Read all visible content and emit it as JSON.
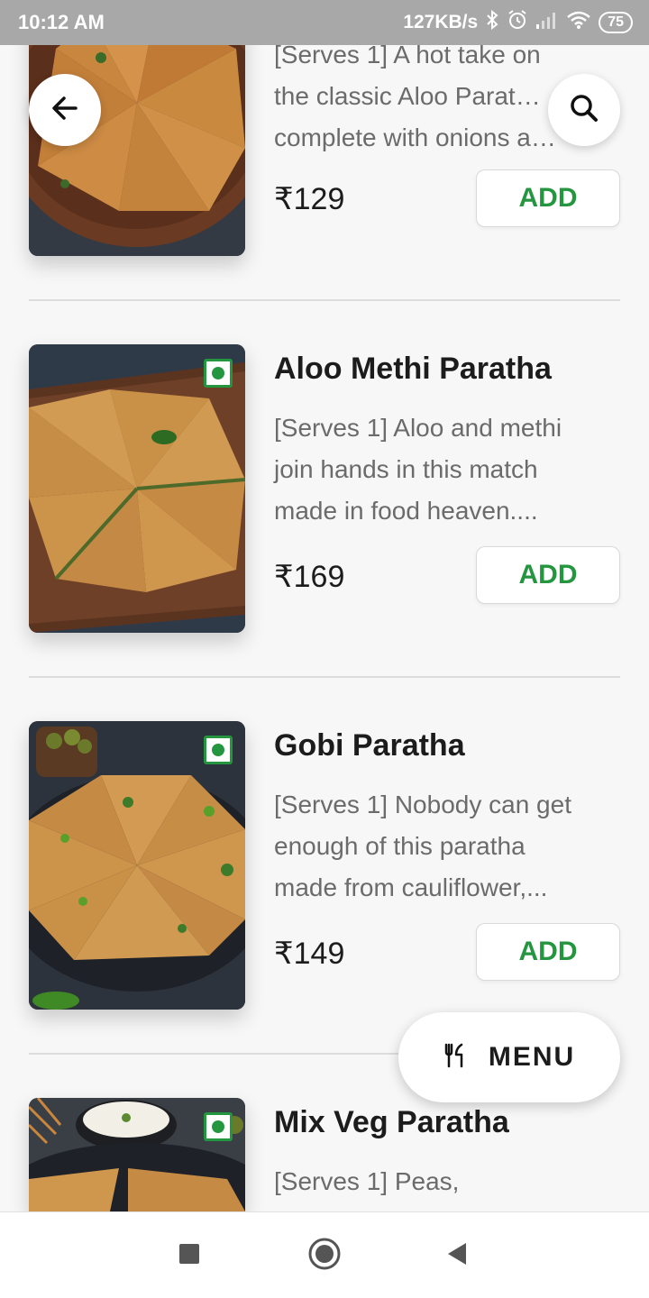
{
  "status_bar": {
    "time": "10:12 AM",
    "speed": "127KB/s",
    "battery": "75"
  },
  "header": {
    "back_icon": "arrow-left-icon",
    "search_icon": "search-icon"
  },
  "items": [
    {
      "title": "",
      "description_lines": [
        "[Serves 1] A hot take on",
        "the classic Aloo Parat…",
        "complete with onions a…"
      ],
      "price": "₹129",
      "add_label": "ADD"
    },
    {
      "title": "Aloo Methi Paratha",
      "description_lines": [
        "[Serves 1] Aloo and methi",
        "join hands in this match",
        "made in food heaven...."
      ],
      "price": "₹169",
      "add_label": "ADD"
    },
    {
      "title": "Gobi Paratha",
      "description_lines": [
        "[Serves 1] Nobody can get",
        "enough of this paratha",
        "made from cauliflower,..."
      ],
      "price": "₹149",
      "add_label": "ADD"
    },
    {
      "title": "Mix Veg Paratha",
      "description_lines": [
        "[Serves 1] Peas,"
      ],
      "price": "",
      "add_label": ""
    }
  ],
  "menu_button": {
    "label": "MENU",
    "icon": "cutlery-icon"
  },
  "nav_bar": {
    "icons": [
      "recents-square-icon",
      "home-circle-icon",
      "back-triangle-icon"
    ]
  },
  "colors": {
    "veg_green": "#24963f",
    "add_green": "#24963f"
  }
}
